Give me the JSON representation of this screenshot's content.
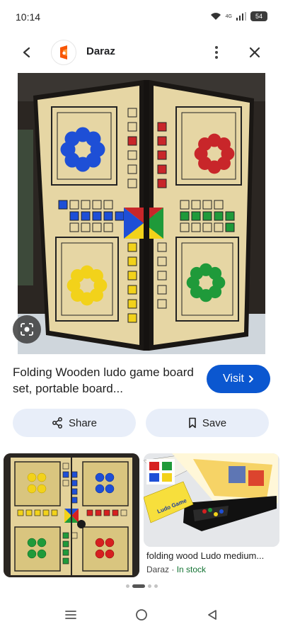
{
  "status_bar": {
    "time": "10:14",
    "network": "4G",
    "battery": "54"
  },
  "app_bar": {
    "site_name": "Daraz",
    "icons": {
      "back": "arrow-left-icon",
      "logo": "daraz-logo-icon",
      "more": "more-vertical-icon",
      "close": "close-icon"
    }
  },
  "main": {
    "lens_icon": "lens-icon",
    "title": "Folding Wooden ludo game board set, portable board...",
    "visit_label": "Visit",
    "visit_icon": "chevron-right-icon"
  },
  "actions": {
    "share_label": "Share",
    "share_icon": "share-icon",
    "save_label": "Save",
    "save_icon": "bookmark-icon"
  },
  "related": {
    "item2": {
      "box_label": "Ludo Game",
      "title": "folding wood Ludo medium...",
      "source": "Daraz",
      "separator": "·",
      "stock": "In stock"
    }
  },
  "pager": {
    "pages": 4,
    "active_index": 1
  },
  "nav_bar": {
    "icons": [
      "menu-icon",
      "home-icon",
      "back-triangle-icon"
    ]
  },
  "colors": {
    "accent": "#0b57d0",
    "pill_bg": "#e8eef9",
    "stock_green": "#137333",
    "ludo_blue": "#1e4fd6",
    "ludo_red": "#d62020",
    "ludo_yellow": "#f2d21a",
    "ludo_green": "#1f9a3a",
    "board_wood": "#e6d6a4"
  }
}
